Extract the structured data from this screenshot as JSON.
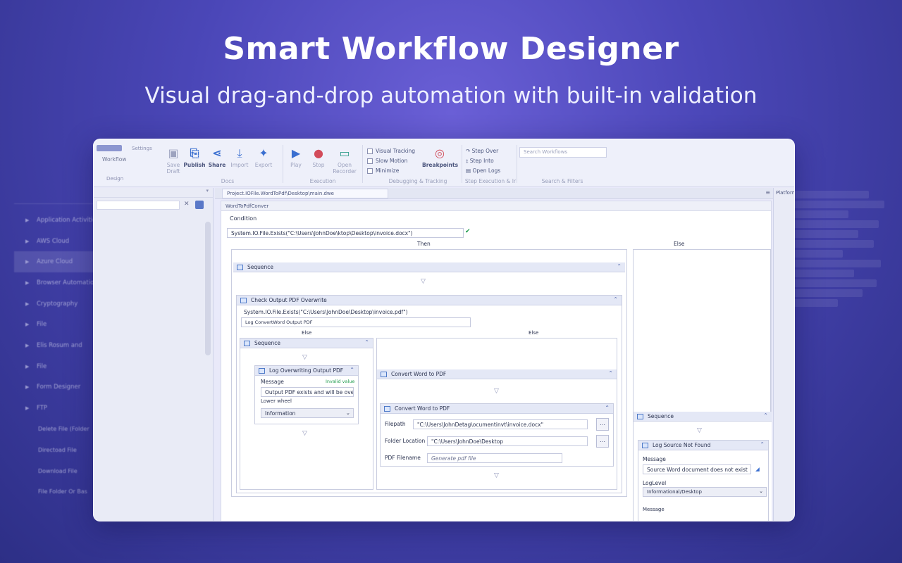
{
  "hero": {
    "title": "Smart Workflow Designer",
    "subtitle": "Visual drag-and-drop automation with built-in validation"
  },
  "background_panel": {
    "items": [
      {
        "label": "Application Activities",
        "selected": false,
        "sub": false
      },
      {
        "label": "AWS Cloud",
        "selected": false,
        "sub": false
      },
      {
        "label": "Azure Cloud",
        "selected": true,
        "sub": false
      },
      {
        "label": "Browser Automation",
        "selected": false,
        "sub": false
      },
      {
        "label": "Cryptography",
        "selected": false,
        "sub": false
      },
      {
        "label": "File",
        "selected": false,
        "sub": false
      },
      {
        "label": "Elis Rosum and",
        "selected": false,
        "sub": false
      },
      {
        "label": "File",
        "selected": false,
        "sub": false
      },
      {
        "label": "Form Designer",
        "selected": false,
        "sub": false
      },
      {
        "label": "FTP",
        "selected": false,
        "sub": false
      },
      {
        "label": "Delete File (Folder",
        "selected": false,
        "sub": true
      },
      {
        "label": "Directoad File",
        "selected": false,
        "sub": true
      },
      {
        "label": "Download File",
        "selected": false,
        "sub": true
      },
      {
        "label": "File Folder Or Bas",
        "selected": false,
        "sub": true
      }
    ]
  },
  "ribbon": {
    "file_tab": "Settings",
    "file_workflow": "Workflow",
    "file_design": "Design",
    "buttons": {
      "save_draft": "Save Draft",
      "publish": "Publish",
      "share": "Share",
      "import": "Import",
      "export": "Export",
      "play": "Play",
      "stop": "Stop",
      "open_recorder": "Open Recorder",
      "breakpoints": "Breakpoints"
    },
    "checks": {
      "visual_tracking": "Visual Tracking",
      "slow_motion": "Slow Motion",
      "minimize": "Minimize"
    },
    "steps": {
      "step_over": "Step Over",
      "step_into": "Step Into",
      "open_logs": "Open Logs"
    },
    "search_placeholder": "Search Workflows",
    "groups": {
      "docs": "Docs",
      "execution": "Execution",
      "debugging": "Debugging & Tracking",
      "step_execution": "Step Execution & Ir",
      "search_filters": "Search & Filters"
    }
  },
  "tab": {
    "label": "Project.IOFile.WordToPdf\\Desktop\\main.dwe"
  },
  "right_panel": {
    "label": "Platform"
  },
  "designer": {
    "workflow_title": "WordToPdfConver",
    "condition_label": "Condition",
    "condition_value": "System.IO.File.Exists(\"C:\\Users\\JohnDoe\\ktop\\Desktop\\invoice.docx\")",
    "then_label": "Then",
    "else_label": "Else",
    "sequence_label": "Sequence",
    "check_output": {
      "title": "Check Output PDF Overwrite",
      "condition": "System.IO.File.Exists(\"C:\\Users\\JohnDoe\\Desktop\\invoice.pdf\")",
      "log_text": "Log ConvertWord Output PDF",
      "else_left": "Else",
      "else_right": "Else"
    },
    "inner_sequence": "Sequence",
    "log_overwrite": {
      "title": "Log Overwriting Output PDF",
      "message_label": "Message",
      "message_hint": "Invalid value",
      "message_value": "Output PDF exists and will be over",
      "level_label": "Lower wheel",
      "level_value": "Information"
    },
    "convert_outer": "Convert Word to PDF",
    "convert_inner": {
      "title": "Convert Word to PDF",
      "filepath_label": "Filepath",
      "filepath_value": "\"C:\\Users\\JohnDetag\\ocumentinvt\\invoice.docx\"",
      "folder_label": "Folder Location",
      "folder_value": "\"C:\\Users\\JohnDoe\\Desktop",
      "filename_label": "PDF Filename",
      "filename_placeholder": "Generate pdf file"
    },
    "else_sequence": "Sequence",
    "log_source": {
      "title": "Log Source Not Found",
      "message_label": "Message",
      "message_value": "Source Word document does not exist",
      "level_label": "LogLevel",
      "level_value": "Informational/Desktop",
      "footer_label": "Message"
    }
  },
  "colors": {
    "accent": "#3a6fd0",
    "valid": "#1e9c4c",
    "background": "#4b47b8"
  }
}
